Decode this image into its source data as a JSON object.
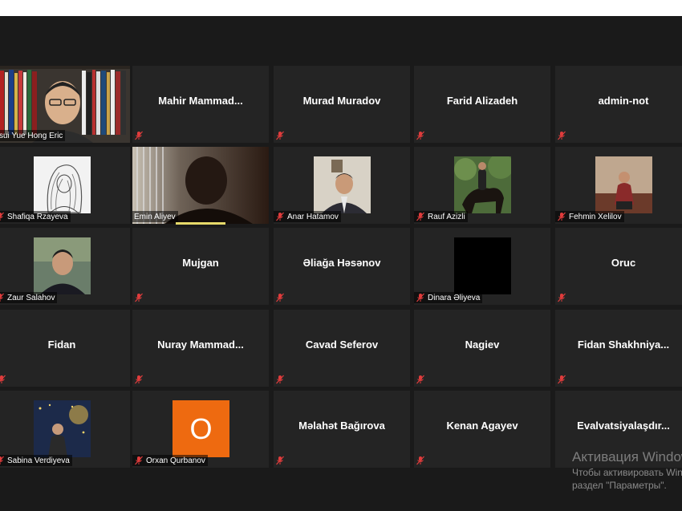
{
  "colors": {
    "background": "#1a1a1a",
    "tile": "#242424",
    "speaker_border": "#e6e65a",
    "muted_red": "#e03c3c",
    "avatar_orange": "#ee6a10"
  },
  "participants": [
    {
      "name": "Tsui Yue Hong Eric",
      "display": "photo",
      "speaker": true,
      "muted": false
    },
    {
      "name": "Mahir  Mammad...",
      "display": "name",
      "muted": true
    },
    {
      "name": "Murad Muradov",
      "display": "name",
      "muted": true
    },
    {
      "name": "Farid Alizadeh",
      "display": "name",
      "muted": true
    },
    {
      "name": "admin-not",
      "display": "name",
      "muted": true
    },
    {
      "name": "Shafiqa Rzayeva",
      "display": "photo",
      "muted": true
    },
    {
      "name": "Emin Aliyev",
      "display": "video",
      "muted": false,
      "active": true
    },
    {
      "name": "Anar Hatamov",
      "display": "photo",
      "muted": true
    },
    {
      "name": "Rauf Azizli",
      "display": "photo",
      "muted": true
    },
    {
      "name": "Fehmin Xelilov",
      "display": "photo",
      "muted": true
    },
    {
      "name": "Zaur Salahov",
      "display": "photo",
      "muted": true
    },
    {
      "name": "Mujgan",
      "display": "name",
      "muted": true
    },
    {
      "name": "Əliağa Həsənov",
      "display": "name",
      "muted": true
    },
    {
      "name": "Dinara Əliyeva",
      "display": "photo",
      "muted": true
    },
    {
      "name": "Oruc",
      "display": "name",
      "muted": true
    },
    {
      "name": "Fidan",
      "display": "name",
      "muted": true
    },
    {
      "name": "Nuray  Mammad...",
      "display": "name",
      "muted": true
    },
    {
      "name": "Cavad Seferov",
      "display": "name",
      "muted": true
    },
    {
      "name": "Nagiev",
      "display": "name",
      "muted": true
    },
    {
      "name": "Fidan  Shakhniya...",
      "display": "name",
      "muted": true
    },
    {
      "name": "Sabina Verdiyeva",
      "display": "photo",
      "muted": true
    },
    {
      "name": "Orxan Qurbanov",
      "display": "avatar",
      "letter": "O",
      "muted": true
    },
    {
      "name": "Məlahət Bağırova",
      "display": "name",
      "muted": true
    },
    {
      "name": "Kenan Agayev",
      "display": "name",
      "muted": true
    },
    {
      "name": "Evalvatsiyalaşdır...",
      "display": "name",
      "muted": true
    }
  ],
  "watermark": {
    "title": "Активация Windows",
    "line1": "Чтобы активировать Windows, перейдите в",
    "line2": "раздел \"Параметры\"."
  }
}
